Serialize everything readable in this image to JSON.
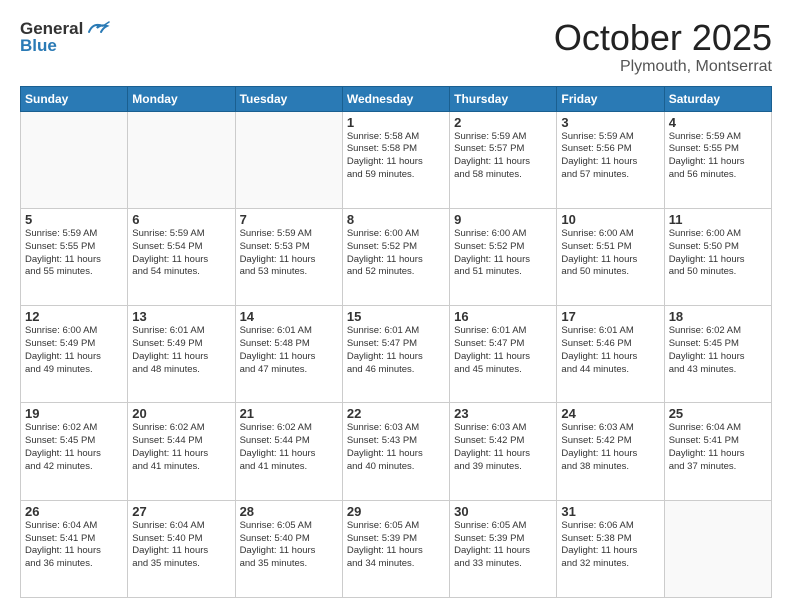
{
  "header": {
    "logo_line1": "General",
    "logo_line2": "Blue",
    "title": "October 2025",
    "subtitle": "Plymouth, Montserrat"
  },
  "days": [
    "Sunday",
    "Monday",
    "Tuesday",
    "Wednesday",
    "Thursday",
    "Friday",
    "Saturday"
  ],
  "weeks": [
    [
      {
        "date": "",
        "info": ""
      },
      {
        "date": "",
        "info": ""
      },
      {
        "date": "",
        "info": ""
      },
      {
        "date": "1",
        "info": "Sunrise: 5:58 AM\nSunset: 5:58 PM\nDaylight: 11 hours\nand 59 minutes."
      },
      {
        "date": "2",
        "info": "Sunrise: 5:59 AM\nSunset: 5:57 PM\nDaylight: 11 hours\nand 58 minutes."
      },
      {
        "date": "3",
        "info": "Sunrise: 5:59 AM\nSunset: 5:56 PM\nDaylight: 11 hours\nand 57 minutes."
      },
      {
        "date": "4",
        "info": "Sunrise: 5:59 AM\nSunset: 5:55 PM\nDaylight: 11 hours\nand 56 minutes."
      }
    ],
    [
      {
        "date": "5",
        "info": "Sunrise: 5:59 AM\nSunset: 5:55 PM\nDaylight: 11 hours\nand 55 minutes."
      },
      {
        "date": "6",
        "info": "Sunrise: 5:59 AM\nSunset: 5:54 PM\nDaylight: 11 hours\nand 54 minutes."
      },
      {
        "date": "7",
        "info": "Sunrise: 5:59 AM\nSunset: 5:53 PM\nDaylight: 11 hours\nand 53 minutes."
      },
      {
        "date": "8",
        "info": "Sunrise: 6:00 AM\nSunset: 5:52 PM\nDaylight: 11 hours\nand 52 minutes."
      },
      {
        "date": "9",
        "info": "Sunrise: 6:00 AM\nSunset: 5:52 PM\nDaylight: 11 hours\nand 51 minutes."
      },
      {
        "date": "10",
        "info": "Sunrise: 6:00 AM\nSunset: 5:51 PM\nDaylight: 11 hours\nand 50 minutes."
      },
      {
        "date": "11",
        "info": "Sunrise: 6:00 AM\nSunset: 5:50 PM\nDaylight: 11 hours\nand 50 minutes."
      }
    ],
    [
      {
        "date": "12",
        "info": "Sunrise: 6:00 AM\nSunset: 5:49 PM\nDaylight: 11 hours\nand 49 minutes."
      },
      {
        "date": "13",
        "info": "Sunrise: 6:01 AM\nSunset: 5:49 PM\nDaylight: 11 hours\nand 48 minutes."
      },
      {
        "date": "14",
        "info": "Sunrise: 6:01 AM\nSunset: 5:48 PM\nDaylight: 11 hours\nand 47 minutes."
      },
      {
        "date": "15",
        "info": "Sunrise: 6:01 AM\nSunset: 5:47 PM\nDaylight: 11 hours\nand 46 minutes."
      },
      {
        "date": "16",
        "info": "Sunrise: 6:01 AM\nSunset: 5:47 PM\nDaylight: 11 hours\nand 45 minutes."
      },
      {
        "date": "17",
        "info": "Sunrise: 6:01 AM\nSunset: 5:46 PM\nDaylight: 11 hours\nand 44 minutes."
      },
      {
        "date": "18",
        "info": "Sunrise: 6:02 AM\nSunset: 5:45 PM\nDaylight: 11 hours\nand 43 minutes."
      }
    ],
    [
      {
        "date": "19",
        "info": "Sunrise: 6:02 AM\nSunset: 5:45 PM\nDaylight: 11 hours\nand 42 minutes."
      },
      {
        "date": "20",
        "info": "Sunrise: 6:02 AM\nSunset: 5:44 PM\nDaylight: 11 hours\nand 41 minutes."
      },
      {
        "date": "21",
        "info": "Sunrise: 6:02 AM\nSunset: 5:44 PM\nDaylight: 11 hours\nand 41 minutes."
      },
      {
        "date": "22",
        "info": "Sunrise: 6:03 AM\nSunset: 5:43 PM\nDaylight: 11 hours\nand 40 minutes."
      },
      {
        "date": "23",
        "info": "Sunrise: 6:03 AM\nSunset: 5:42 PM\nDaylight: 11 hours\nand 39 minutes."
      },
      {
        "date": "24",
        "info": "Sunrise: 6:03 AM\nSunset: 5:42 PM\nDaylight: 11 hours\nand 38 minutes."
      },
      {
        "date": "25",
        "info": "Sunrise: 6:04 AM\nSunset: 5:41 PM\nDaylight: 11 hours\nand 37 minutes."
      }
    ],
    [
      {
        "date": "26",
        "info": "Sunrise: 6:04 AM\nSunset: 5:41 PM\nDaylight: 11 hours\nand 36 minutes."
      },
      {
        "date": "27",
        "info": "Sunrise: 6:04 AM\nSunset: 5:40 PM\nDaylight: 11 hours\nand 35 minutes."
      },
      {
        "date": "28",
        "info": "Sunrise: 6:05 AM\nSunset: 5:40 PM\nDaylight: 11 hours\nand 35 minutes."
      },
      {
        "date": "29",
        "info": "Sunrise: 6:05 AM\nSunset: 5:39 PM\nDaylight: 11 hours\nand 34 minutes."
      },
      {
        "date": "30",
        "info": "Sunrise: 6:05 AM\nSunset: 5:39 PM\nDaylight: 11 hours\nand 33 minutes."
      },
      {
        "date": "31",
        "info": "Sunrise: 6:06 AM\nSunset: 5:38 PM\nDaylight: 11 hours\nand 32 minutes."
      },
      {
        "date": "",
        "info": ""
      }
    ]
  ]
}
